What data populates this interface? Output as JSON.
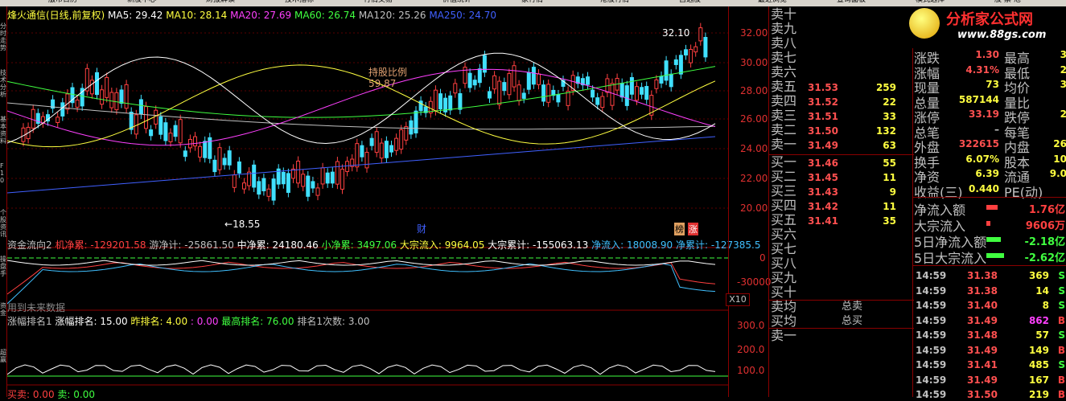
{
  "top_menu": [
    "服币日历",
    "新股中心",
    "财报解读",
    "技术指标",
    "行情交易",
    "价值统计",
    "家行情",
    "港股行情",
    "自选股",
    "最近浏览",
    "查询面板",
    "模式选择",
    "股 票 池"
  ],
  "left_tabs": [
    "分时走势",
    "技术分析",
    "基本资料",
    "F10",
    "个股资讯",
    "操盘手",
    "资金",
    "超赢"
  ],
  "main": {
    "stock_name": "烽火通信(日线,前复权)",
    "ma": [
      {
        "label": "MA5: 29.42",
        "color": "#ffffff"
      },
      {
        "label": "MA10: 28.14",
        "color": "#ffff40"
      },
      {
        "label": "MA20: 27.69",
        "color": "#ff40ff"
      },
      {
        "label": "MA60: 26.74",
        "color": "#40ff40"
      },
      {
        "label": "MA120: 25.26",
        "color": "#c0c0c0"
      },
      {
        "label": "MA250: 24.70",
        "color": "#4060ff"
      }
    ],
    "high_marker": "32.10",
    "low_marker": "18.55",
    "holding_title": "持股比例",
    "holding_value": "59.87",
    "caibao": "财",
    "bang": "榜",
    "zhang": "涨",
    "price_axis": [
      "32.00",
      "30.00",
      "28.00",
      "26.00",
      "24.00",
      "22.00",
      "20.00"
    ],
    "accent": "#e03030"
  },
  "flow": {
    "name": "资金流向2",
    "items": [
      {
        "label": "机净累: -129201.58",
        "color": "#ff4040"
      },
      {
        "label": "游净计: -25861.50",
        "color": "#c0c0c0"
      },
      {
        "label": "中净累: 24180.46",
        "color": "#ffffff"
      },
      {
        "label": "小净累: 3497.06",
        "color": "#40ff40"
      },
      {
        "label": "大宗流入: 9964.05",
        "color": "#ffff40"
      },
      {
        "label": "大宗累计: -155063.13",
        "color": "#ffffff"
      },
      {
        "label": "净流入: 18008.90",
        "color": "#40c0ff"
      },
      {
        "label": "净累计: -127385.5",
        "color": "#40c0ff"
      }
    ],
    "axis": [
      "0",
      "-30000"
    ],
    "unit": "X10",
    "note": "用到未来数据"
  },
  "rank": {
    "name": "涨幅排名1",
    "items": [
      {
        "label": "涨幅排名: 15.00",
        "color": "#ffffff"
      },
      {
        "label": "昨排名: 4.00",
        "color": "#ffff40"
      },
      {
        "label": ": 0.00",
        "color": "#ff40ff"
      },
      {
        "label": "最高排名: 76.00",
        "color": "#40ff40"
      },
      {
        "label": "排名1次数: 3.00",
        "color": "#c0c0c0"
      }
    ],
    "axis": [
      "300.0",
      "200.0",
      "100.0"
    ]
  },
  "bottom": {
    "buy": "买卖: 0.00",
    "sell": "卖: 0.00"
  },
  "brand": {
    "text": "分析家公式网",
    "url": "www.88gs.com"
  },
  "orderbook": {
    "asks": [
      {
        "label": "卖十",
        "price": "",
        "vol": ""
      },
      {
        "label": "卖九",
        "price": "",
        "vol": ""
      },
      {
        "label": "卖八",
        "price": "",
        "vol": ""
      },
      {
        "label": "卖七",
        "price": "",
        "vol": ""
      },
      {
        "label": "卖六",
        "price": "",
        "vol": ""
      },
      {
        "label": "卖五",
        "price": "31.53",
        "vol": "259"
      },
      {
        "label": "卖四",
        "price": "31.52",
        "vol": "22"
      },
      {
        "label": "卖三",
        "price": "31.51",
        "vol": "33"
      },
      {
        "label": "卖二",
        "price": "31.50",
        "vol": "132"
      },
      {
        "label": "卖一",
        "price": "31.49",
        "vol": "63"
      }
    ],
    "bids": [
      {
        "label": "买一",
        "price": "31.46",
        "vol": "55"
      },
      {
        "label": "买二",
        "price": "31.45",
        "vol": "11"
      },
      {
        "label": "买三",
        "price": "31.43",
        "vol": "9"
      },
      {
        "label": "买四",
        "price": "31.42",
        "vol": "11"
      },
      {
        "label": "买五",
        "price": "31.41",
        "vol": "35"
      },
      {
        "label": "买六",
        "price": "",
        "vol": ""
      },
      {
        "label": "买七",
        "price": "",
        "vol": ""
      },
      {
        "label": "买八",
        "price": "",
        "vol": ""
      },
      {
        "label": "买九",
        "price": "",
        "vol": ""
      },
      {
        "label": "买十",
        "price": "",
        "vol": ""
      }
    ],
    "avg_sell": "卖均",
    "avg_buy": "买均",
    "total_sell": "总卖",
    "total_buy": "总买",
    "sell_one": "卖一"
  },
  "stats": [
    {
      "l": "涨跌",
      "v": "1.30",
      "vc": "#ff5050",
      "r": "最高",
      "rv": "3"
    },
    {
      "l": "涨幅",
      "v": "4.31%",
      "vc": "#ff5050",
      "r": "最低",
      "rv": "2"
    },
    {
      "l": "现量",
      "v": "73",
      "vc": "#ffff40",
      "r": "均价",
      "rv": "3"
    },
    {
      "l": "总量",
      "v": "587144",
      "vc": "#ffff40",
      "r": "量比",
      "rv": ""
    },
    {
      "l": "涨停",
      "v": "33.19",
      "vc": "#ff5050",
      "r": "跌停",
      "rv": "2"
    },
    {
      "l": "总笔",
      "v": "–",
      "vc": "#c0c0c0",
      "r": "每笔",
      "rv": ""
    },
    {
      "l": "外盘",
      "v": "322615",
      "vc": "#ff5050",
      "r": "内盘",
      "rv": "26"
    },
    {
      "l": "换手",
      "v": "6.07%",
      "vc": "#ffff40",
      "r": "股本",
      "rv": "10"
    },
    {
      "l": "净资",
      "v": "6.39",
      "vc": "#ffff40",
      "r": "流通",
      "rv": "9.0"
    },
    {
      "l": "收益(三)",
      "v": "0.440",
      "vc": "#ffff40",
      "r": "PE(动)",
      "rv": ""
    }
  ],
  "capital": [
    {
      "l": "净流入额",
      "v": "1.76亿",
      "c": "#ff4040",
      "bar": 0.35
    },
    {
      "l": "大宗流入",
      "v": "9606万",
      "c": "#ff4040",
      "bar": 0.12
    },
    {
      "l": "5日净流入额",
      "v": "-2.18亿",
      "c": "#40ff40",
      "bar": 0.45
    },
    {
      "l": "5日大宗流入",
      "v": "-2.62亿",
      "c": "#40ff40",
      "bar": 0.55
    }
  ],
  "ticks": [
    {
      "t": "14:59",
      "p": "31.38",
      "v": "369",
      "s": "S",
      "c": "#40ff40",
      "vc": "#ffff40"
    },
    {
      "t": "14:59",
      "p": "31.38",
      "v": "14",
      "s": "S",
      "c": "#40ff40",
      "vc": "#ffff40"
    },
    {
      "t": "14:59",
      "p": "31.40",
      "v": "8",
      "s": "S",
      "c": "#40ff40",
      "vc": "#ffff40"
    },
    {
      "t": "14:59",
      "p": "31.49",
      "v": "862",
      "s": "B",
      "c": "#ff4040",
      "vc": "#ff40ff"
    },
    {
      "t": "14:59",
      "p": "31.48",
      "v": "57",
      "s": "S",
      "c": "#40ff40",
      "vc": "#ffff40"
    },
    {
      "t": "14:59",
      "p": "31.49",
      "v": "149",
      "s": "B",
      "c": "#ff4040",
      "vc": "#ffff40"
    },
    {
      "t": "14:59",
      "p": "31.41",
      "v": "485",
      "s": "S",
      "c": "#40ff40",
      "vc": "#ffff40"
    },
    {
      "t": "14:59",
      "p": "31.49",
      "v": "167",
      "s": "B",
      "c": "#ff4040",
      "vc": "#ffff40"
    },
    {
      "t": "14:59",
      "p": "31.50",
      "v": "219",
      "s": "B",
      "c": "#ff4040",
      "vc": "#ffff40"
    }
  ]
}
